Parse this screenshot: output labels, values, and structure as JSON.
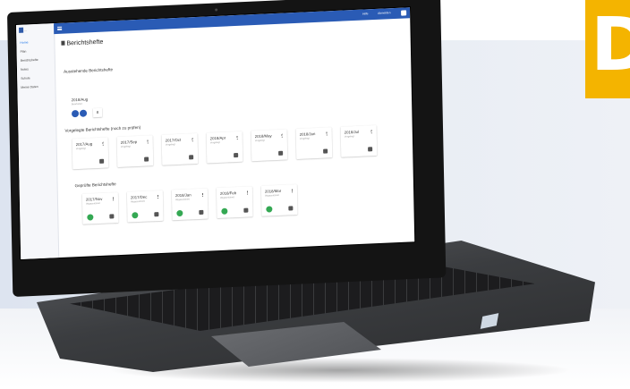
{
  "badge": {
    "letter": "D",
    "color": "#f4b400"
  },
  "app": {
    "logo_text": "...",
    "sidebar": [
      {
        "label": "Home",
        "active": true
      },
      {
        "label": "Plan",
        "active": false
      },
      {
        "label": "Berichtshefte",
        "active": false
      },
      {
        "label": "Notes",
        "active": false
      },
      {
        "label": "Schule",
        "active": false
      },
      {
        "label": "Meine Daten",
        "active": false
      }
    ],
    "topbar": {
      "link1": "Hilfe",
      "link2": "Abmelden",
      "color": "#2a5bb5"
    },
    "page_title": "Berichtshefte",
    "sections": {
      "open": "Ausstehende Berichtshefte",
      "submitted": "Vorgelegte Berichtshefte (noch zu prüfen)",
      "checked": "Geprüfte Berichtshefte"
    },
    "open_item": {
      "title": "2018/Aug",
      "sub": "Bearbeitet",
      "button_label": "B"
    },
    "submitted_items": [
      {
        "title": "2017/Aug",
        "sub": "Vorgelegt"
      },
      {
        "title": "2017/Sep",
        "sub": "Vorgelegt"
      },
      {
        "title": "2017/Oct",
        "sub": "Vorgelegt"
      },
      {
        "title": "2018/Apr",
        "sub": "Vorgelegt"
      },
      {
        "title": "2018/May",
        "sub": "Vorgelegt"
      },
      {
        "title": "2018/Jun",
        "sub": "Vorgelegt"
      },
      {
        "title": "2018/Jul",
        "sub": "Vorgelegt"
      }
    ],
    "checked_items": [
      {
        "title": "2017/Nov",
        "sub": "Abgezeichnet"
      },
      {
        "title": "2017/Dec",
        "sub": "Abgezeichnet"
      },
      {
        "title": "2018/Jan",
        "sub": "Abgezeichnet"
      },
      {
        "title": "2018/Feb",
        "sub": "Abgezeichnet"
      },
      {
        "title": "2018/Mar",
        "sub": "Abgezeichnet"
      }
    ]
  }
}
